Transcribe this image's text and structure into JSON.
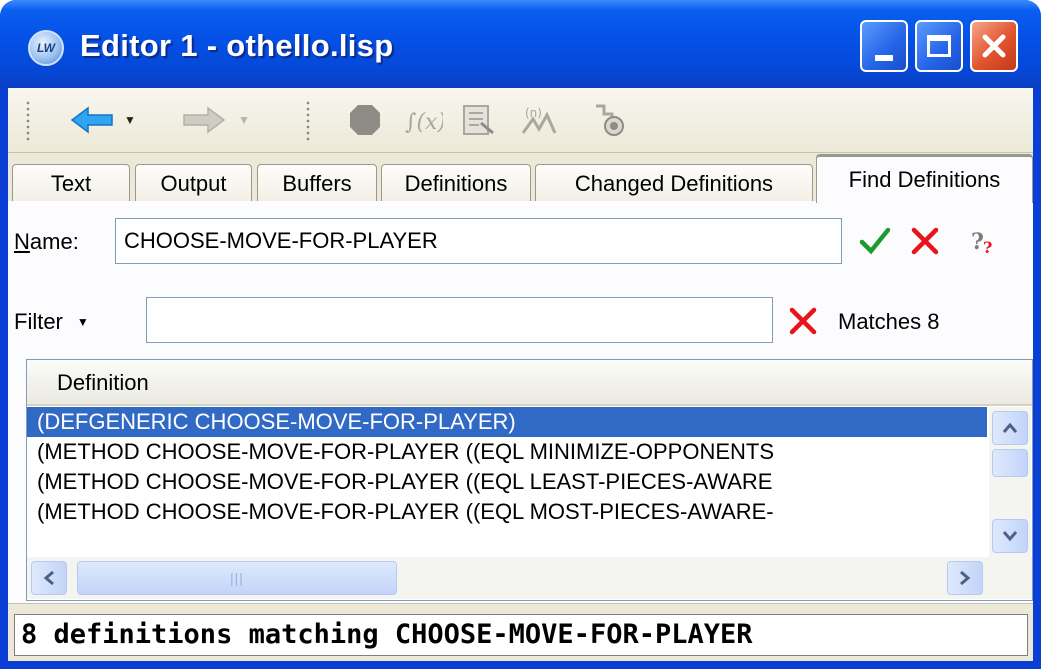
{
  "window": {
    "title": "Editor 1 - othello.lisp",
    "app_icon_text": "LW",
    "colors": {
      "titlebar": "#0550e6",
      "close": "#e0542e",
      "selection": "#316ac5",
      "tab_highlight": "#f9b233"
    }
  },
  "toolbar": {
    "icons": [
      "back-arrow-icon",
      "forward-arrow-icon",
      "stop-icon",
      "evaluate-icon",
      "compile-icon",
      "macroexpand-icon",
      "inspect-icon"
    ]
  },
  "tabs": [
    {
      "label": "Text",
      "active": false
    },
    {
      "label": "Output",
      "active": false
    },
    {
      "label": "Buffers",
      "active": false
    },
    {
      "label": "Definitions",
      "active": false
    },
    {
      "label": "Changed Definitions",
      "active": false
    },
    {
      "label": "Find Definitions",
      "active": true
    }
  ],
  "name_field": {
    "label_mnemonic": "N",
    "label_rest": "ame:",
    "value": "CHOOSE-MOVE-FOR-PLAYER"
  },
  "filter": {
    "label": "Filter",
    "value": "",
    "matches_text": "Matches 8"
  },
  "list": {
    "column_header": "Definition",
    "rows": [
      "(DEFGENERIC CHOOSE-MOVE-FOR-PLAYER)",
      "(METHOD CHOOSE-MOVE-FOR-PLAYER ((EQL MINIMIZE-OPPONENTS",
      "(METHOD CHOOSE-MOVE-FOR-PLAYER ((EQL LEAST-PIECES-AWARE",
      "(METHOD CHOOSE-MOVE-FOR-PLAYER ((EQL MOST-PIECES-AWARE-"
    ],
    "selected_index": 0
  },
  "status": {
    "text": "8 definitions matching CHOOSE-MOVE-FOR-PLAYER"
  }
}
